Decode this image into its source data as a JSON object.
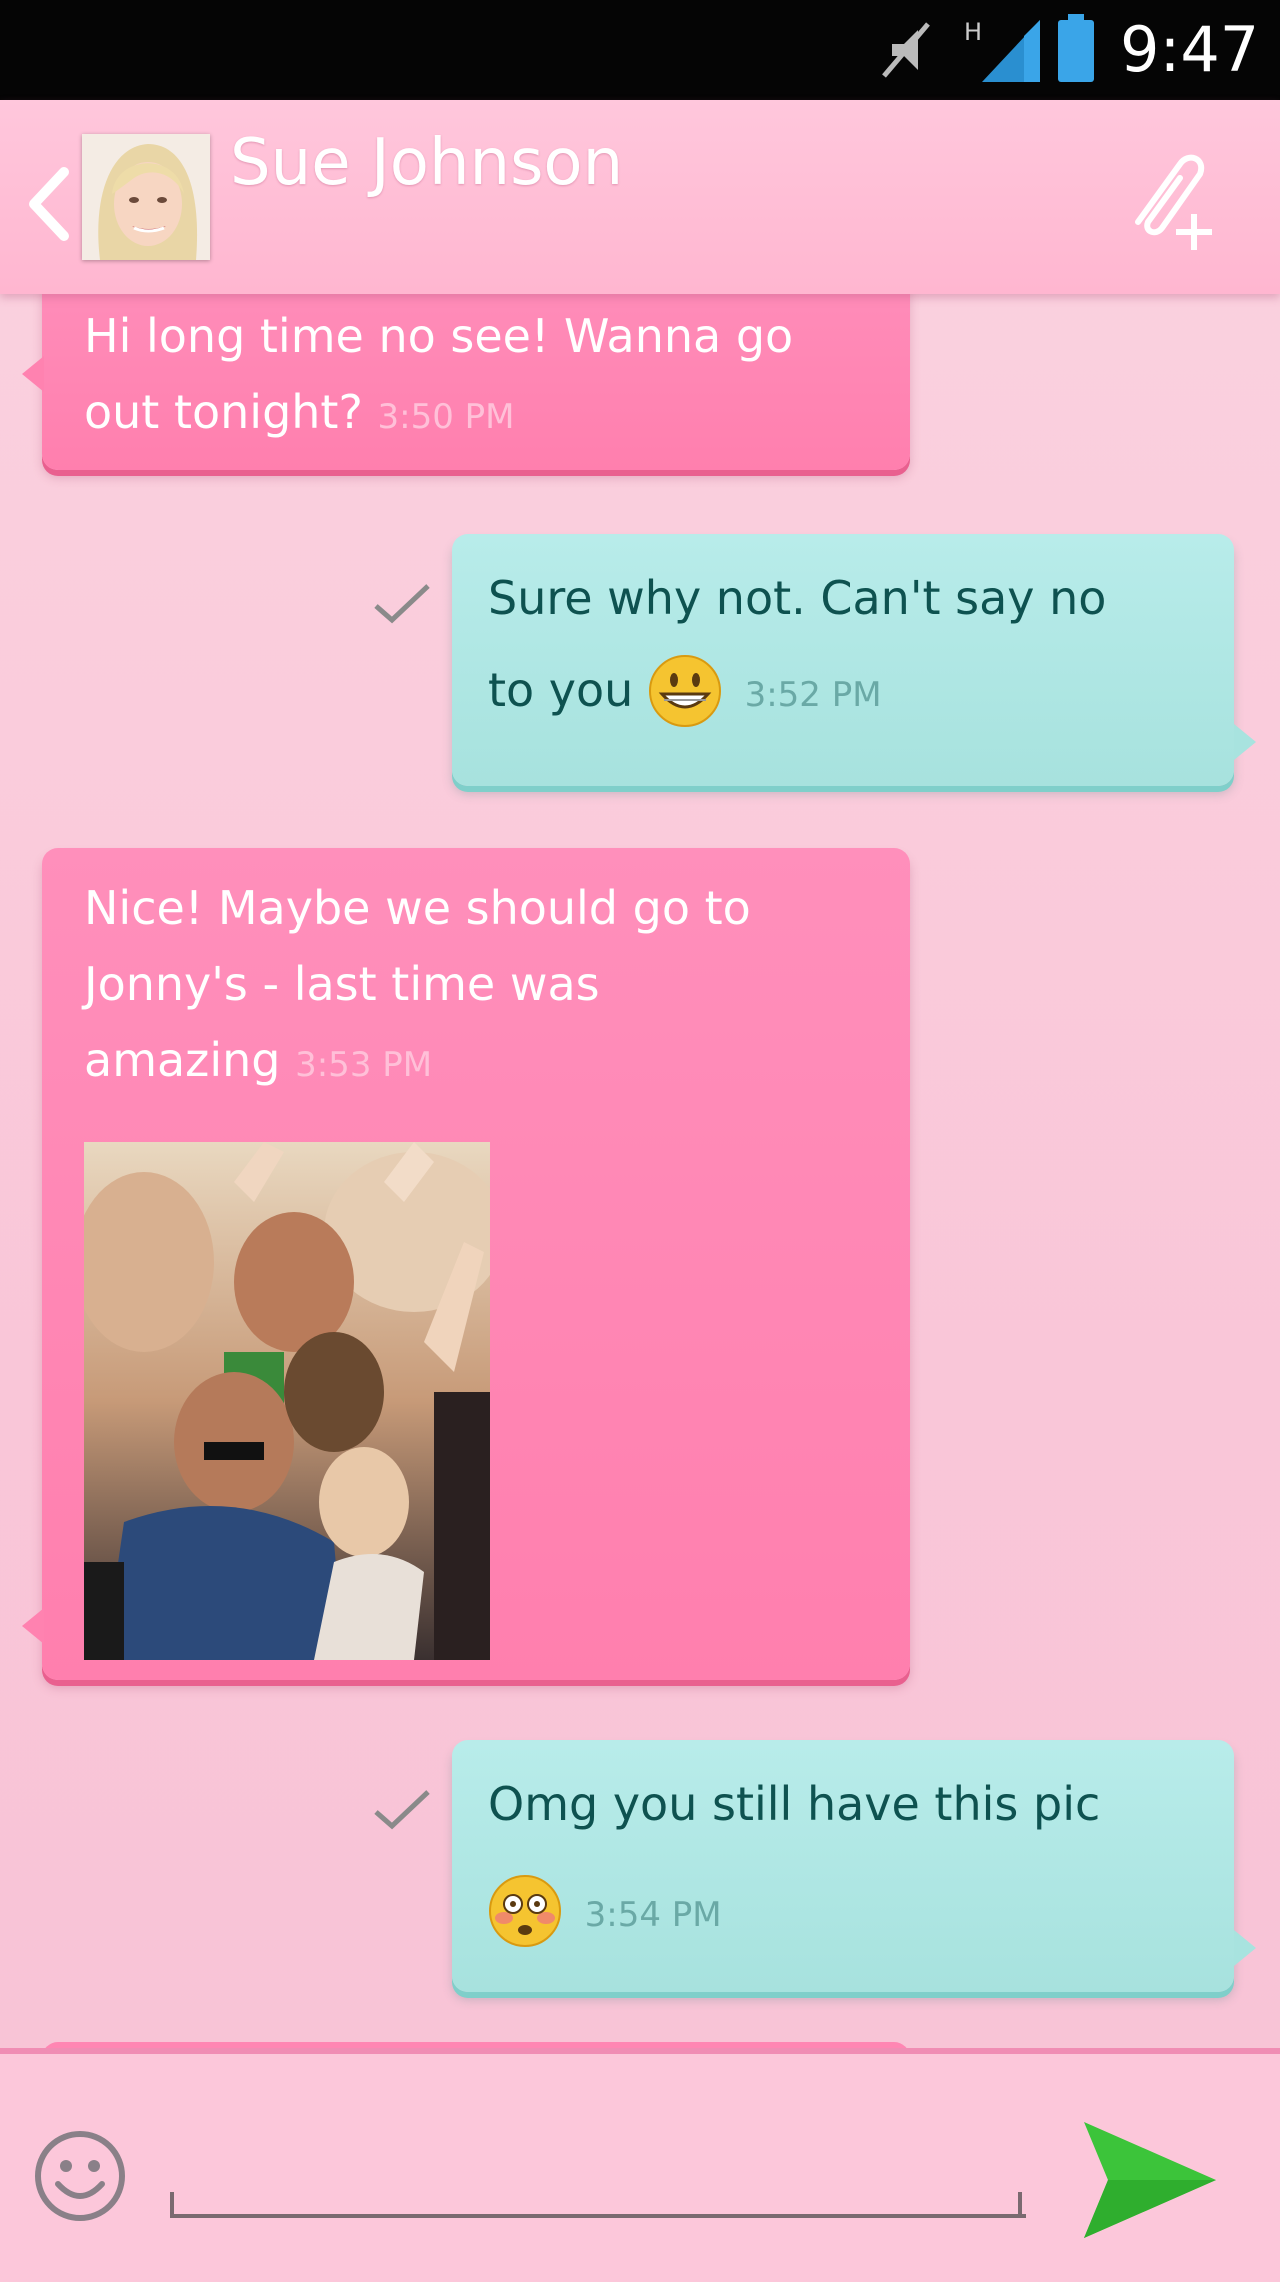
{
  "status_bar": {
    "time": "9:47",
    "network_type": "H",
    "icons": [
      "mute-icon",
      "signal-icon",
      "battery-icon"
    ]
  },
  "header": {
    "contact_name": "Sue Johnson",
    "back_icon": "chevron-left-icon",
    "attach_icon": "attach-add-icon"
  },
  "messages": [
    {
      "direction": "incoming",
      "text_lines": [
        "Hi long time no see! Wanna go",
        "out tonight?"
      ],
      "time": "3:50 PM"
    },
    {
      "direction": "outgoing",
      "text_lines": [
        "Sure why not. Can't say no",
        "to you"
      ],
      "emoji": "grinning-face",
      "time": "3:52 PM",
      "status": "sent-check"
    },
    {
      "direction": "incoming",
      "text_lines": [
        "Nice! Maybe we should go to",
        "Jonny's - last time was",
        "amazing"
      ],
      "time": "3:53 PM",
      "attachment": "photo"
    },
    {
      "direction": "outgoing",
      "text_lines": [
        "Omg you still have this pic"
      ],
      "emoji": "flushed-face",
      "time": "3:54 PM",
      "status": "sent-check"
    }
  ],
  "input": {
    "placeholder": "",
    "value": "",
    "emoji_button_icon": "smiley-icon",
    "send_icon": "send-icon"
  },
  "colors": {
    "background": "#f9c6d8",
    "header": "#ffbcd4",
    "incoming_bubble": "#ff86b3",
    "outgoing_bubble": "#abe4e0",
    "send_arrow": "#3cc43a"
  }
}
